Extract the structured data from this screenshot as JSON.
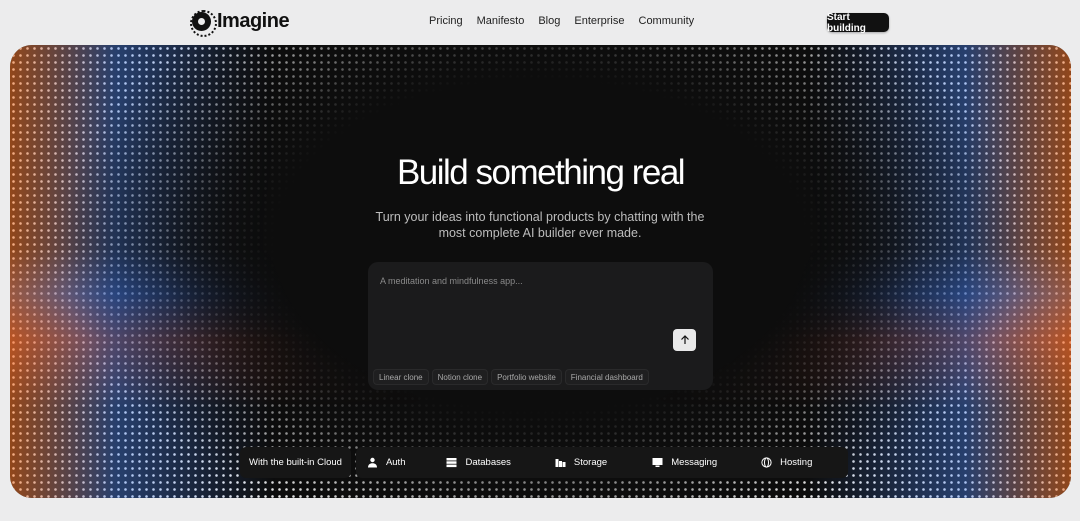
{
  "brand": {
    "name": "Imagine"
  },
  "nav": {
    "links": [
      "Pricing",
      "Manifesto",
      "Blog",
      "Enterprise",
      "Community"
    ],
    "cta": "Start building"
  },
  "hero": {
    "title": "Build something real",
    "subtitle": "Turn your ideas into functional products by chatting with the most complete AI builder ever made.",
    "prompt": {
      "placeholder": "A meditation and mindfulness app...",
      "send_icon": "arrow-up-icon"
    },
    "suggestions": [
      "Linear clone",
      "Notion clone",
      "Portfolio website",
      "Financial dashboard"
    ]
  },
  "cloud": {
    "label": "With the built-in Cloud",
    "features": [
      {
        "label": "Auth",
        "icon": "user-icon"
      },
      {
        "label": "Databases",
        "icon": "database-icon"
      },
      {
        "label": "Storage",
        "icon": "storage-icon"
      },
      {
        "label": "Messaging",
        "icon": "monitor-icon"
      },
      {
        "label": "Hosting",
        "icon": "globe-icon"
      }
    ]
  },
  "colors": {
    "background": "#ececed",
    "hero": "#0d0d0d",
    "accent": "#111111"
  }
}
